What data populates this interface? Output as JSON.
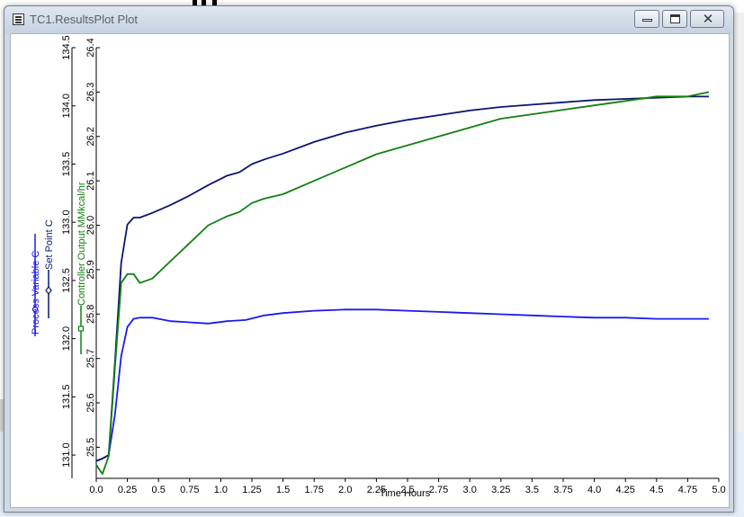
{
  "window": {
    "title": "TC1.ResultsPlot Plot"
  },
  "colors": {
    "process_variable": "#1a1aee",
    "set_point": "#0c1470",
    "controller_output": "#128012",
    "axis": "#000000"
  },
  "chart_data": {
    "type": "line",
    "xlabel": "Time Hours",
    "xlim": [
      0,
      5
    ],
    "x_ticks": [
      "0.0",
      "0.25",
      "0.5",
      "0.75",
      "1.0",
      "1.25",
      "1.5",
      "1.75",
      "2.0",
      "2.25",
      "2.5",
      "2.75",
      "3.0",
      "3.25",
      "3.5",
      "3.75",
      "4.0",
      "4.25",
      "4.5",
      "4.75",
      "5.0"
    ],
    "grid": false,
    "axes": [
      {
        "id": "left",
        "labels": [
          "Process Variable C",
          "Set Point C"
        ],
        "ylim": [
          130.8,
          134.5
        ],
        "ticks": [
          "131.0",
          "131.5",
          "132.0",
          "132.5",
          "133.0",
          "133.5",
          "134.0",
          "134.5"
        ]
      },
      {
        "id": "right",
        "labels": [
          "Controller Output MMkcal/hr"
        ],
        "ylim": [
          25.43,
          26.4
        ],
        "ticks": [
          "25.5",
          "25.6",
          "25.7",
          "25.8",
          "25.9",
          "26.0",
          "26.1",
          "26.2",
          "26.3",
          "26.4"
        ]
      }
    ],
    "series": [
      {
        "name": "Process Variable C",
        "axis": "left",
        "x": [
          0,
          0.05,
          0.1,
          0.15,
          0.2,
          0.25,
          0.3,
          0.35,
          0.45,
          0.6,
          0.75,
          0.9,
          1.05,
          1.2,
          1.35,
          1.5,
          1.75,
          2.0,
          2.25,
          2.5,
          2.75,
          3.0,
          3.25,
          3.5,
          3.75,
          4.0,
          4.25,
          4.5,
          4.75,
          4.92
        ],
        "y": [
          130.95,
          130.97,
          131.0,
          131.35,
          131.85,
          132.1,
          132.17,
          132.18,
          132.18,
          132.15,
          132.14,
          132.13,
          132.15,
          132.16,
          132.2,
          132.22,
          132.24,
          132.25,
          132.25,
          132.24,
          132.23,
          132.22,
          132.21,
          132.2,
          132.19,
          132.18,
          132.18,
          132.17,
          132.17,
          132.17
        ]
      },
      {
        "name": "Set Point C",
        "axis": "left",
        "x": [
          0,
          0.05,
          0.1,
          0.15,
          0.2,
          0.25,
          0.3,
          0.35,
          0.45,
          0.6,
          0.75,
          0.9,
          1.05,
          1.15,
          1.25,
          1.35,
          1.5,
          1.75,
          2.0,
          2.25,
          2.5,
          2.75,
          3.0,
          3.25,
          3.5,
          3.75,
          4.0,
          4.25,
          4.5,
          4.75,
          4.92
        ],
        "y": [
          130.95,
          130.97,
          131.0,
          131.8,
          132.65,
          132.98,
          133.04,
          133.04,
          133.08,
          133.15,
          133.23,
          133.32,
          133.4,
          133.43,
          133.5,
          133.54,
          133.59,
          133.69,
          133.77,
          133.83,
          133.88,
          133.92,
          133.96,
          133.99,
          134.01,
          134.03,
          134.05,
          134.06,
          134.07,
          134.08,
          134.08
        ]
      },
      {
        "name": "Controller Output MMkcal/hr",
        "axis": "right",
        "x": [
          0,
          0.05,
          0.1,
          0.15,
          0.2,
          0.25,
          0.3,
          0.35,
          0.45,
          0.6,
          0.75,
          0.9,
          1.05,
          1.15,
          1.25,
          1.35,
          1.5,
          1.75,
          2.0,
          2.25,
          2.5,
          2.75,
          3.0,
          3.25,
          3.5,
          3.75,
          4.0,
          4.25,
          4.5,
          4.75,
          4.92
        ],
        "y": [
          25.46,
          25.44,
          25.48,
          25.68,
          25.87,
          25.89,
          25.89,
          25.87,
          25.88,
          25.92,
          25.96,
          26.0,
          26.02,
          26.03,
          26.05,
          26.06,
          26.07,
          26.1,
          26.13,
          26.16,
          26.18,
          26.2,
          26.22,
          26.24,
          26.25,
          26.26,
          26.27,
          26.28,
          26.29,
          26.29,
          26.3
        ]
      }
    ]
  }
}
